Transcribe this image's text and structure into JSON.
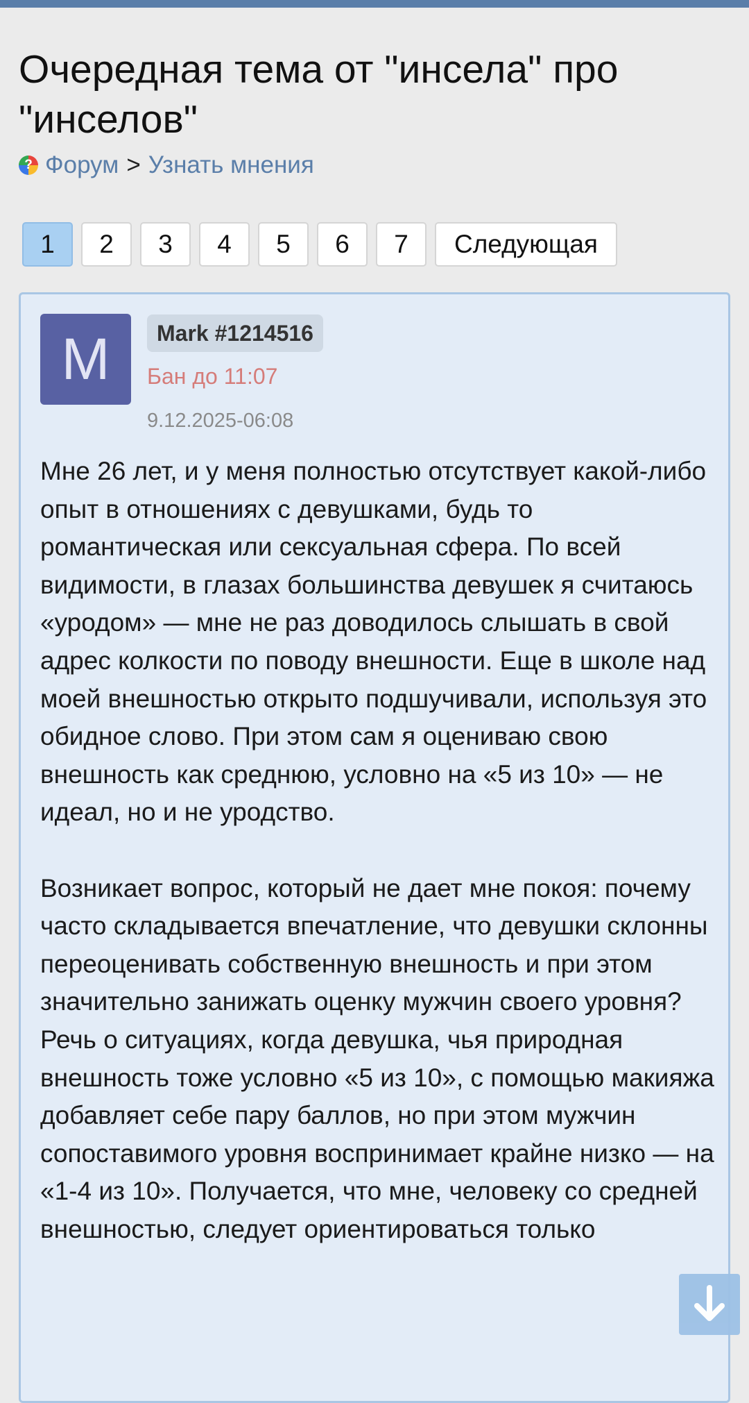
{
  "header": {
    "title": "Очередная тема от \"инсела\" про \"инселов\""
  },
  "breadcrumb": {
    "forum": "Форум",
    "separator": ">",
    "section": "Узнать мнения"
  },
  "pagination": {
    "pages": [
      "1",
      "2",
      "3",
      "4",
      "5",
      "6",
      "7"
    ],
    "active_page": "1",
    "next_label": "Следующая"
  },
  "post": {
    "avatar_letter": "M",
    "author": "Mark #1214516",
    "ban_status": "Бан до 11:07",
    "date": "9.12.2025-06:08",
    "paragraphs": [
      "Мне 26 лет, и у меня полностью отсутствует какой-либо опыт в отношениях с девушками, будь то романтическая или сексуальная сфера. По всей видимости, в глазах большинства девушек я считаюсь «уродом» — мне не раз доводилось слышать в свой адрес колкости по поводу внешности. Еще в школе над моей внешностью открыто подшучивали, используя это обидное слово. При этом сам я оцениваю свою внешность как среднюю, условно на «5 из 10» — не идеал, но и не уродство.",
      "Возникает вопрос, который не дает мне покоя: почему часто складывается впечатление, что девушки склонны переоценивать собственную внешность и при этом значительно занижать оценку мужчин своего уровня? Речь о ситуациях, когда девушка, чья природная внешность тоже условно «5 из 10», с помощью макияжа добавляет себе пару баллов, но при этом мужчин сопоставимого уровня воспринимает крайне низко — на «1-4 из 10». Получается, что мне, человеку со средней внешностью, следует ориентироваться только"
    ]
  },
  "icons": {
    "forum": "forum-logo-icon",
    "scroll": "arrow-down-icon"
  },
  "colors": {
    "accent": "#5a7ea9",
    "active_page": "#a9d0f2",
    "post_background": "#e3ecf7",
    "ban": "#d57c79",
    "avatar": "#5861a3"
  }
}
